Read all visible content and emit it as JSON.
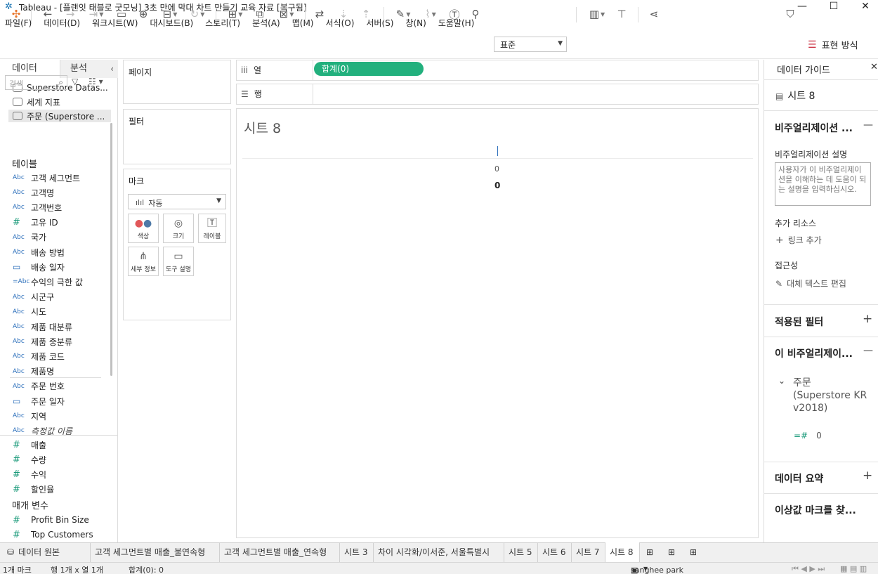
{
  "window": {
    "title": "Tableau - [플랜잇 태블로 굿모닝] 3초 만에 막대 차트 만들기 교육 자료 [복구됨]"
  },
  "menu": [
    "파일(F)",
    "데이터(D)",
    "워크시트(W)",
    "대시보드(B)",
    "스토리(T)",
    "분석(A)",
    "맵(M)",
    "서식(O)",
    "서버(S)",
    "창(N)",
    "도움말(H)"
  ],
  "toolbar": {
    "fit_value": "표준",
    "present_label": "표현 방식"
  },
  "data_pane": {
    "tab_data": "데이터",
    "tab_analysis": "분석",
    "sources": [
      "Superstore Datas...",
      "세계 지표",
      "주문 (Superstore ..."
    ],
    "search_placeholder": "검색",
    "tables_header": "테이블",
    "fields": [
      {
        "type": "Abc",
        "name": "고객 세그먼트"
      },
      {
        "type": "Abc",
        "name": "고객명"
      },
      {
        "type": "Abc",
        "name": "고객번호"
      },
      {
        "type": "#",
        "name": "고유 ID"
      },
      {
        "type": "Abc",
        "name": "국가"
      },
      {
        "type": "Abc",
        "name": "배송 방법"
      },
      {
        "type": "cal",
        "name": "배송 일자"
      },
      {
        "type": "=Abc",
        "name": "수익의 극한 값"
      },
      {
        "type": "Abc",
        "name": "시군구"
      },
      {
        "type": "Abc",
        "name": "시도"
      },
      {
        "type": "Abc",
        "name": "제품 대분류"
      },
      {
        "type": "Abc",
        "name": "제품 중분류"
      },
      {
        "type": "Abc",
        "name": "제품 코드"
      },
      {
        "type": "Abc",
        "name": "제품명"
      },
      {
        "type": "Abc",
        "name": "주문 번호"
      },
      {
        "type": "cal",
        "name": "주문 일자"
      },
      {
        "type": "Abc",
        "name": "지역"
      },
      {
        "type": "Abc",
        "name": "측정값 이름"
      }
    ],
    "measures": [
      "매출",
      "수량",
      "수익",
      "할인율"
    ],
    "params_header": "매개 변수",
    "params": [
      "Profit Bin Size",
      "Top Customers"
    ]
  },
  "cards": {
    "pages": "페이지",
    "filters": "필터",
    "marks": "마크",
    "mark_type": "자동",
    "mark_buttons": [
      "색상",
      "크기",
      "레이블",
      "세부 정보",
      "도구 설명"
    ]
  },
  "shelves": {
    "columns": "열",
    "rows": "행",
    "column_pill": "합계(0)"
  },
  "view": {
    "title": "시트 8",
    "axis_tick": "0",
    "axis_label": "0"
  },
  "guide": {
    "header": "데이터 가이드",
    "sheet": "시트 8",
    "viz_section": "비주얼리제이션 ...",
    "viz_desc_label": "비주얼리제이션 설명",
    "viz_desc_placeholder": "사용자가 이 비주얼리제이션을 이해하는 데 도움이 되는 설명을 입력하십시오.",
    "extra_resources": "추가 리소스",
    "add_link": "링크 추가",
    "accessibility": "접근성",
    "edit_alt": "대체 텍스트 편집",
    "applied_filters": "적용된 필터",
    "this_viz": "이 비주얼리제이...",
    "source_line1": "주문",
    "source_line2": "(Superstore KR",
    "source_line3": "v2018)",
    "field_zero": "0",
    "data_summary": "데이터 요약",
    "outliers": "이상값 마크를 찾..."
  },
  "sheet_tabs": [
    "데이터 원본",
    "고객 세그먼트별 매출_불연속형",
    "고객 세그먼트별 매출_연속형",
    "시트 3",
    "차이 시각화/이서준, 서울특별시",
    "시트 5",
    "시트 6",
    "시트 7",
    "시트 8"
  ],
  "status": {
    "marks": "1개 마크",
    "rowcol": "행 1개 x 열 1개",
    "sum": "합계(0): 0",
    "user": "sanghee park"
  }
}
